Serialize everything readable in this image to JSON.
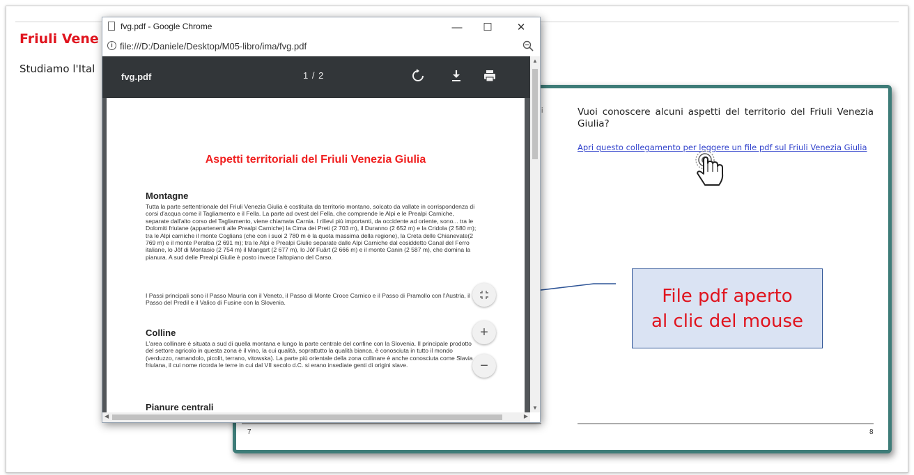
{
  "background": {
    "title": "Friuli Vene",
    "subtitle": "Studiamo l'Ital"
  },
  "book": {
    "intro": "Vuoi conoscere alcuni aspetti del territorio del Friuli Venezia Giulia?",
    "link": "Apri questo collegamento per leggere un file pdf sul Friuli Venezia Giulia",
    "fragment": "i",
    "page_left": "7",
    "page_right": "8",
    "frame_color": "#3e7c78"
  },
  "callout": {
    "line1": "File pdf aperto",
    "line2": "al clic del mouse"
  },
  "window": {
    "title": "fvg.pdf - Google Chrome",
    "url": "file:///D:/Daniele/Desktop/M05-libro/ima/fvg.pdf",
    "minimize": "—",
    "maximize": "☐",
    "close": "✕"
  },
  "viewer": {
    "file_name": "fvg.pdf",
    "page_indicator": "1 / 2",
    "icons": [
      "rotate-icon",
      "download-icon",
      "print-icon"
    ],
    "fab_fit": "fit-to-page-icon",
    "fab_zoom_in": "+",
    "fab_zoom_out": "−"
  },
  "pdf": {
    "title": "Aspetti territoriali del Friuli Venezia Giulia",
    "sections": {
      "montagne": {
        "heading": "Montagne",
        "p1": "Tutta la parte settentrionale del Friuli Venezia Giulia è costituita da territorio montano, solcato da vallate in corrispondenza di corsi d'acqua come il Tagliamento e il Fella. La parte ad ovest del Fella, che comprende le Alpi e le Prealpi Carniche, separate dall'alto corso del Tagliamento, viene chiamata Carnia. I rilievi più importanti, da occidente ad oriente, sono... tra le Dolomiti friulane (appartenenti alle Prealpi Carniche) la Cima dei Preti (2 703 m), il Duranno (2 652 m) e la Cridola (2 580 m); tra le Alpi carniche il monte Coglians (che con i suoi 2 780 m è la quota massima della regione), la Creta delle Chianevate(2 769 m) e il monte Peralba (2 691 m); tra le Alpi e Prealpi Giulie separate dalle Alpi Carniche dal cosiddetto Canal del Ferro italiane, lo Jôf di Montasio (2 754 m) il Mangart (2 677 m), lo Jôf Fuârt (2 666 m) e il monte Canin (2 587 m), che domina la pianura. A sud delle Prealpi Giulie è posto invece l'altopiano del Carso.",
        "p2": "I Passi principali sono il Passo Mauria con il Veneto, il Passo di Monte Croce Carnico e il Passo di Pramollo con l'Austria, il Passo del Predil e il Valico di Fusine con la Slovenia."
      },
      "colline": {
        "heading": "Colline",
        "p1": "L'area collinare è situata a sud di quella montana e lungo la parte centrale del confine con la Slovenia. Il principale prodotto del settore agricolo in questa zona è il vino, la cui qualità, soprattutto la qualità bianca, è conosciuta in tutto il mondo (verduzzo, ramandolo, picolit, terrano, vitowska). La parte più orientale della zona collinare è anche conosciuta come Slavia friulana, il cui nome ricorda le terre in cui dal VII secolo d.C. si erano insediate genti di origini slave."
      },
      "pianure": {
        "heading": "Pianure centrali"
      }
    }
  }
}
